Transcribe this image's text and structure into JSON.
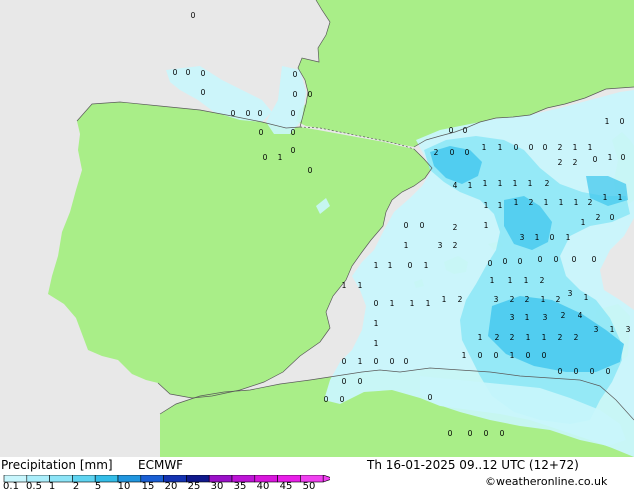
{
  "product": {
    "title": "Precipitation [mm]",
    "model": "ECMWF",
    "valid_time": "Th 16-01-2025 09..12 UTC (12+72)",
    "credit": "©weatheronline.co.uk"
  },
  "colors": {
    "sea": "#e8e8e8",
    "land": "#a9ee88",
    "precip_light": "#c9f6fc",
    "precip_mid": "#8fe8f6",
    "precip_strong": "#45c8ee"
  },
  "legend": {
    "labels": [
      "0.1",
      "0.5",
      "1",
      "2",
      "5",
      "10",
      "15",
      "20",
      "25",
      "30",
      "35",
      "40",
      "45",
      "50"
    ],
    "colors": [
      "#c8f6fd",
      "#abeefb",
      "#8ce4f7",
      "#5fd4f1",
      "#34bde8",
      "#2196df",
      "#1a5fd4",
      "#1433b2",
      "#10198c",
      "#9a10c8",
      "#bd14d6",
      "#d816dc",
      "#e81ee8",
      "#f040f0"
    ]
  },
  "stations": [
    {
      "v": "0"
    },
    {
      "v": "0"
    },
    {
      "v": "0"
    },
    {
      "v": "0"
    },
    {
      "v": "0"
    },
    {
      "v": "0"
    },
    {
      "v": "0"
    },
    {
      "v": "0"
    },
    {
      "v": "0"
    },
    {
      "v": "0"
    },
    {
      "v": "0"
    },
    {
      "v": "0"
    },
    {
      "v": "0"
    },
    {
      "v": "0"
    },
    {
      "v": "1"
    },
    {
      "v": "0"
    },
    {
      "v": "0"
    },
    {
      "v": "0"
    },
    {
      "v": "0"
    },
    {
      "v": "0"
    },
    {
      "v": "2"
    },
    {
      "v": "0"
    },
    {
      "v": "0"
    },
    {
      "v": "1"
    },
    {
      "v": "1"
    },
    {
      "v": "0"
    },
    {
      "v": "0"
    },
    {
      "v": "0"
    },
    {
      "v": "2"
    },
    {
      "v": "1"
    },
    {
      "v": "1"
    },
    {
      "v": "1"
    },
    {
      "v": "0"
    },
    {
      "v": "4"
    },
    {
      "v": "1"
    },
    {
      "v": "1"
    },
    {
      "v": "1"
    },
    {
      "v": "1"
    },
    {
      "v": "1"
    },
    {
      "v": "2"
    },
    {
      "v": "2"
    },
    {
      "v": "2"
    },
    {
      "v": "0"
    },
    {
      "v": "1"
    },
    {
      "v": "0"
    },
    {
      "v": "1"
    },
    {
      "v": "1"
    },
    {
      "v": "1"
    },
    {
      "v": "2"
    },
    {
      "v": "1"
    },
    {
      "v": "1"
    },
    {
      "v": "1"
    },
    {
      "v": "2"
    },
    {
      "v": "1"
    },
    {
      "v": "1"
    },
    {
      "v": "0"
    },
    {
      "v": "0"
    },
    {
      "v": "1"
    },
    {
      "v": "3"
    },
    {
      "v": "2"
    },
    {
      "v": "2"
    },
    {
      "v": "1"
    },
    {
      "v": "3"
    },
    {
      "v": "1"
    },
    {
      "v": "0"
    },
    {
      "v": "1"
    },
    {
      "v": "1"
    },
    {
      "v": "2"
    },
    {
      "v": "0"
    },
    {
      "v": "0"
    },
    {
      "v": "0"
    },
    {
      "v": "0"
    },
    {
      "v": "0"
    },
    {
      "v": "0"
    },
    {
      "v": "0"
    },
    {
      "v": "0"
    },
    {
      "v": "1"
    },
    {
      "v": "1"
    },
    {
      "v": "0"
    },
    {
      "v": "1"
    },
    {
      "v": "1"
    },
    {
      "v": "1"
    },
    {
      "v": "1"
    },
    {
      "v": "2"
    },
    {
      "v": "3"
    },
    {
      "v": "1"
    },
    {
      "v": "3"
    },
    {
      "v": "2"
    },
    {
      "v": "2"
    },
    {
      "v": "1"
    },
    {
      "v": "2"
    },
    {
      "v": "0"
    },
    {
      "v": "1"
    },
    {
      "v": "1"
    },
    {
      "v": "1"
    },
    {
      "v": "1"
    },
    {
      "v": "2"
    },
    {
      "v": "3"
    },
    {
      "v": "1"
    },
    {
      "v": "3"
    },
    {
      "v": "2"
    },
    {
      "v": "4"
    },
    {
      "v": "3"
    },
    {
      "v": "1"
    },
    {
      "v": "3"
    },
    {
      "v": "1"
    },
    {
      "v": "2"
    },
    {
      "v": "2"
    },
    {
      "v": "1"
    },
    {
      "v": "1"
    },
    {
      "v": "2"
    },
    {
      "v": "2"
    },
    {
      "v": "1"
    },
    {
      "v": "1"
    },
    {
      "v": "1"
    },
    {
      "v": "1"
    },
    {
      "v": "0"
    },
    {
      "v": "1"
    },
    {
      "v": "0"
    },
    {
      "v": "0"
    },
    {
      "v": "0"
    },
    {
      "v": "0"
    },
    {
      "v": "0"
    },
    {
      "v": "0"
    },
    {
      "v": "0"
    },
    {
      "v": "0"
    },
    {
      "v": "1"
    },
    {
      "v": "0"
    },
    {
      "v": "0"
    },
    {
      "v": "1"
    },
    {
      "v": "0"
    },
    {
      "v": "0"
    },
    {
      "v": "0"
    },
    {
      "v": "0"
    },
    {
      "v": "0"
    },
    {
      "v": "0"
    },
    {
      "v": "0"
    },
    {
      "v": "0"
    },
    {
      "v": "0"
    },
    {
      "v": "0"
    }
  ]
}
